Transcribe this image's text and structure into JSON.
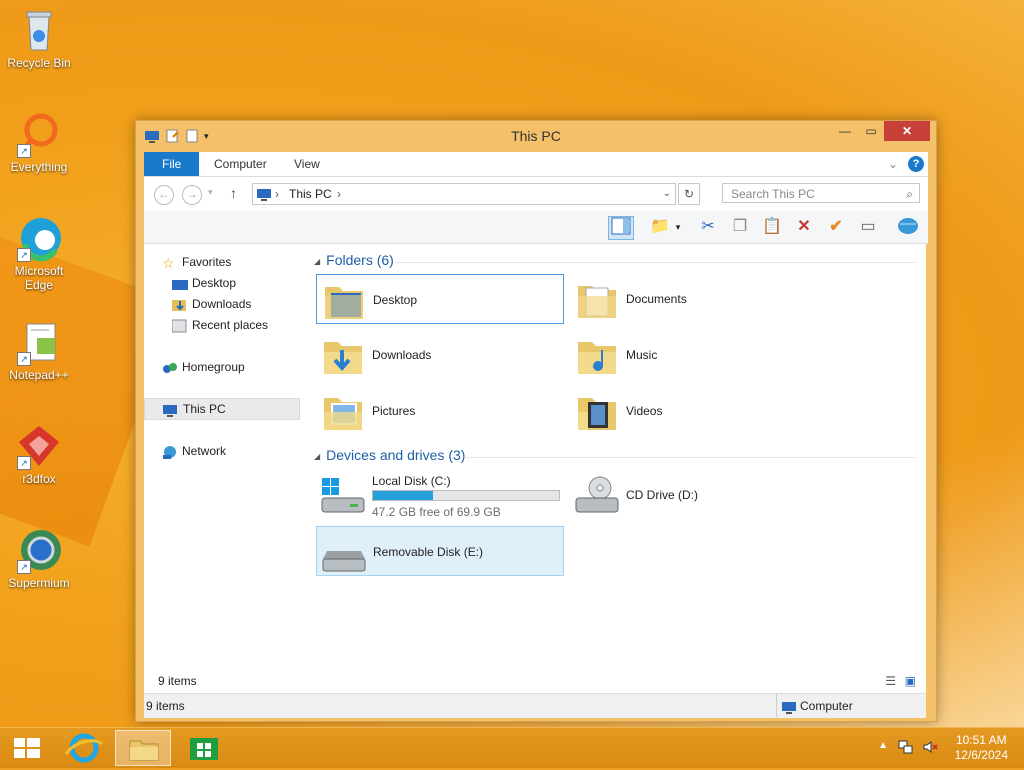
{
  "desktop": {
    "icons": [
      {
        "label": "Recycle Bin",
        "icon": "recycle-bin-icon"
      },
      {
        "label": "Everything",
        "icon": "everything-icon"
      },
      {
        "label": "Microsoft Edge",
        "icon": "edge-icon"
      },
      {
        "label": "Notepad++",
        "icon": "notepad-plus-plus-icon"
      },
      {
        "label": "r3dfox",
        "icon": "r3dfox-icon"
      },
      {
        "label": "Supermium",
        "icon": "supermium-icon"
      }
    ]
  },
  "window": {
    "title": "This PC",
    "ribbon_tabs": [
      "File",
      "Computer",
      "View"
    ],
    "address": {
      "segment": "This PC",
      "separator": "›"
    },
    "search_placeholder": "Search This PC",
    "nav": {
      "favorites": "Favorites",
      "desktop": "Desktop",
      "downloads": "Downloads",
      "recent": "Recent places",
      "homegroup": "Homegroup",
      "this_pc": "This PC",
      "network": "Network"
    },
    "folders_header": "Folders (6)",
    "folders": [
      {
        "name": "Desktop",
        "icon": "desktop-folder-icon"
      },
      {
        "name": "Documents",
        "icon": "documents-folder-icon"
      },
      {
        "name": "Downloads",
        "icon": "downloads-folder-icon"
      },
      {
        "name": "Music",
        "icon": "music-folder-icon"
      },
      {
        "name": "Pictures",
        "icon": "pictures-folder-icon"
      },
      {
        "name": "Videos",
        "icon": "videos-folder-icon"
      }
    ],
    "devices_header": "Devices and drives (3)",
    "drives": {
      "c": {
        "name": "Local Disk (C:)",
        "free_text": "47.2 GB free of 69.9 GB",
        "used_fraction": 0.325
      },
      "d": {
        "name": "CD Drive (D:)"
      },
      "e": {
        "name": "Removable Disk (E:)"
      }
    },
    "item_count": "9 items",
    "status_count": "9 items",
    "status_location": "Computer"
  },
  "taskbar": {
    "time": "10:51 AM",
    "date": "12/6/2024"
  },
  "colors": {
    "accent": "#1979ca",
    "taskbar": "#e49a22",
    "close": "#c7413a"
  }
}
